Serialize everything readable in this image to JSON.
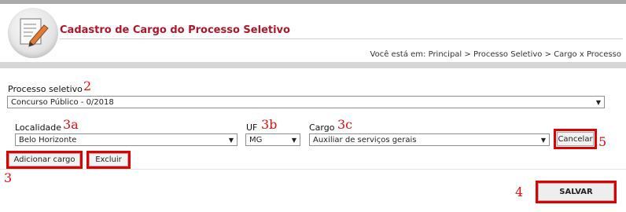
{
  "header": {
    "title": "Cadastro de Cargo do Processo Seletivo",
    "breadcrumb_prefix": "Você está em:",
    "breadcrumb": [
      "Principal",
      "Processo Seletivo",
      "Cargo x Processo"
    ],
    "breadcrumb_sep": ">"
  },
  "form": {
    "processo_label": "Processo seletivo",
    "processo_value": "Concurso Público - 0/2018",
    "localidade_label": "Localidade",
    "localidade_value": "Belo Horizonte",
    "uf_label": "UF",
    "uf_value": "MG",
    "cargo_label": "Cargo",
    "cargo_value": "Auxiliar de serviços gerais",
    "cancel_label": "Cancelar",
    "add_label": "Adicionar cargo",
    "delete_label": "Excluir",
    "save_label": "SALVAR"
  },
  "annotations": {
    "n2": "2",
    "n3a": "3a",
    "n3b": "3b",
    "n3c": "3c",
    "n5": "5",
    "n3": "3",
    "n4": "4"
  },
  "colors": {
    "title": "#b0162a",
    "highlight": "#e00000",
    "annotation": "#e01010"
  },
  "icons": {
    "logo": "edit-document-icon",
    "dropdown": "caret-down-icon"
  }
}
